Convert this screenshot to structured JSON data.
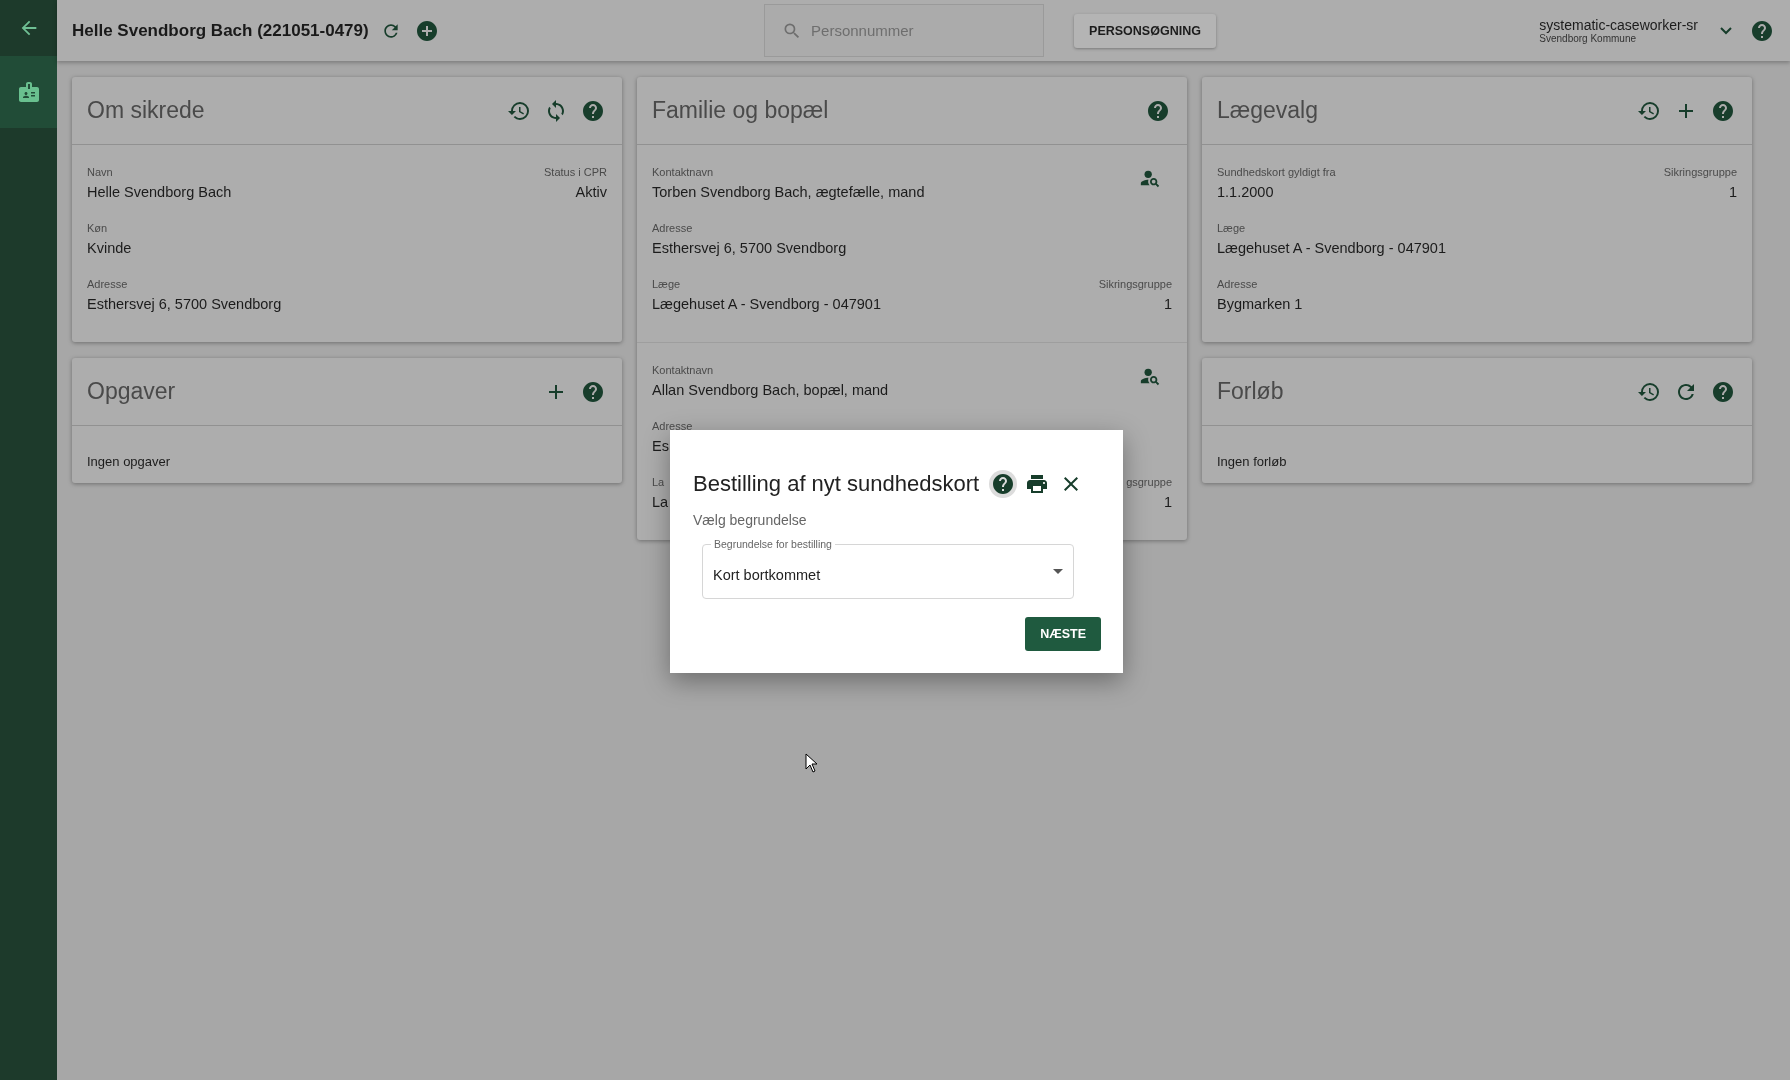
{
  "sidebar": {
    "items": [
      {
        "kind": "card",
        "selected": true
      }
    ]
  },
  "topbar": {
    "title": "Helle Svendborg Bach (221051-0479)",
    "search": {
      "placeholder": "Personnummer"
    },
    "search_button": "PERSONSØGNING",
    "user": {
      "name": "systematic-caseworker-sr",
      "org": "Svendborg Kommune"
    }
  },
  "columns": [
    [
      {
        "title": "Om sikrede",
        "actions": [
          {
            "kind": "history"
          },
          {
            "kind": "sync"
          },
          {
            "kind": "help"
          }
        ],
        "sections": [
          {
            "lookup": false,
            "rows": [
              {
                "label": "Navn",
                "value": "Helle Svendborg Bach",
                "right_label": "Status i CPR",
                "right_value": "Aktiv"
              },
              {
                "label": "Køn",
                "value": "Kvinde"
              },
              {
                "label": "Adresse",
                "value": "Esthersvej 6, 5700 Svendborg"
              }
            ]
          }
        ]
      },
      {
        "title": "Opgaver",
        "actions": [
          {
            "kind": "add"
          },
          {
            "kind": "help"
          }
        ],
        "empty": "Ingen opgaver"
      }
    ],
    [
      {
        "title": "Familie og bopæl",
        "actions": [
          {
            "kind": "help"
          }
        ],
        "sections": [
          {
            "lookup": true,
            "rows": [
              {
                "label": "Kontaktnavn",
                "value": "Torben Svendborg Bach, ægtefælle, mand"
              },
              {
                "label": "Adresse",
                "value": "Esthersvej 6, 5700 Svendborg"
              },
              {
                "label": "Læge",
                "value": "Lægehuset A - Svendborg - 047901",
                "right_label": "Sikringsgruppe",
                "right_value": "1"
              }
            ]
          },
          {
            "lookup": true,
            "rows": [
              {
                "label": "Kontaktnavn",
                "value": "Allan Svendborg Bach, bopæl, mand"
              },
              {
                "label": "Adresse",
                "value": "Es"
              },
              {
                "label": "La",
                "value": "La",
                "right_label": "gsgruppe",
                "right_value": "1"
              }
            ]
          }
        ]
      }
    ],
    [
      {
        "title": "Lægevalg",
        "actions": [
          {
            "kind": "history"
          },
          {
            "kind": "add"
          },
          {
            "kind": "help"
          }
        ],
        "sections": [
          {
            "lookup": false,
            "rows": [
              {
                "label": "Sundhedskort gyldigt fra",
                "value": "1.1.2000",
                "right_label": "Sikringsgruppe",
                "right_value": "1"
              },
              {
                "label": "Læge",
                "value": "Lægehuset A - Svendborg - 047901"
              },
              {
                "label": "Adresse",
                "value": "Bygmarken 1"
              }
            ]
          }
        ]
      },
      {
        "title": "Forløb",
        "actions": [
          {
            "kind": "history"
          },
          {
            "kind": "refresh"
          },
          {
            "kind": "help"
          }
        ],
        "empty": "Ingen forløb"
      }
    ]
  ],
  "dialog": {
    "title": "Bestilling af nyt sundhedskort",
    "actions": [
      {
        "kind": "help",
        "selected": true
      },
      {
        "kind": "print",
        "selected": false
      },
      {
        "kind": "close",
        "selected": false
      }
    ],
    "subtitle": "Vælg begrundelse",
    "select": {
      "label": "Begrundelse for bestilling",
      "value": "Kort bortkommet"
    },
    "button": "NÆSTE"
  }
}
